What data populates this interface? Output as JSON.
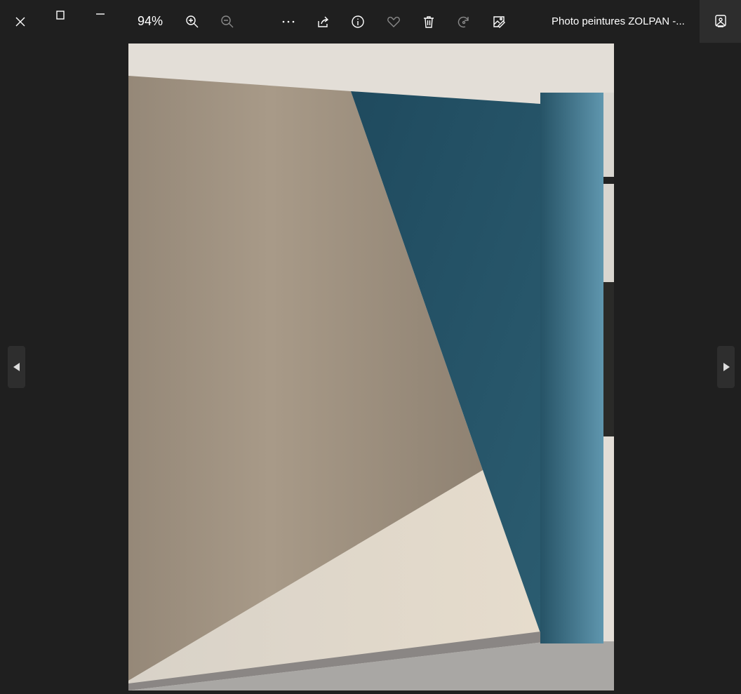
{
  "toolbar": {
    "zoom_level": "94%",
    "file_title": "Photo peintures ZOLPAN -...",
    "icons": [
      "close-icon",
      "maximize-icon",
      "minimize-icon",
      "zoom-in-icon",
      "zoom-out-icon",
      "more-icon",
      "share-icon",
      "info-icon",
      "favorite-icon",
      "delete-icon",
      "rotate-icon",
      "edit-icon",
      "gallery-icon"
    ]
  },
  "colors": {
    "background": "#1f1f1f",
    "wall_beige": "#a59888",
    "wall_blue": "#2e5a6c"
  }
}
